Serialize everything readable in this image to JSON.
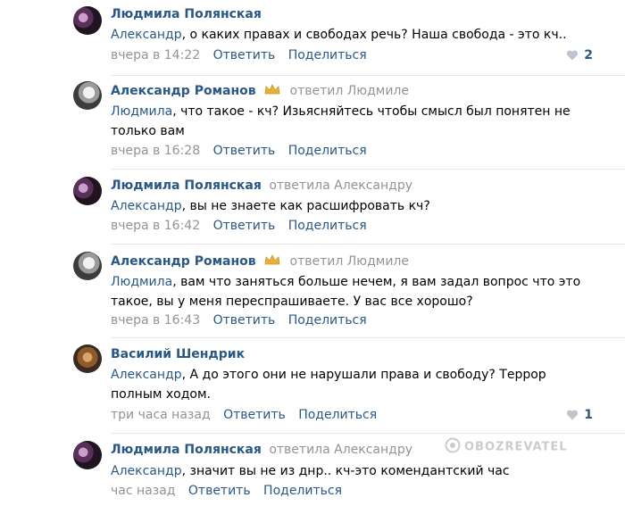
{
  "comments": [
    {
      "author": "Людмила Полянская",
      "replied": "",
      "addressee": "Александр",
      "text": ", о каких правах и свободах речь? Наша свобода - это кч..",
      "time": "вчера в 14:22",
      "reply_label": "Ответить",
      "share_label": "Поделиться",
      "likes": "2",
      "avatar": "lyudmila"
    },
    {
      "author": "Александр Романов",
      "replied": "ответил Людмиле",
      "addressee": "Людмила",
      "text": ", что такое - кч? Изьясняйтесь чтобы смысл был понятен не только вам",
      "time": "вчера в 16:28",
      "reply_label": "Ответить",
      "share_label": "Поделиться",
      "likes": "",
      "avatar": "romanov"
    },
    {
      "author": "Людмила Полянская",
      "replied": "ответила Александру",
      "addressee": "Александр",
      "text": ", вы не знаете как расшифровать кч?",
      "time": "вчера в 16:42",
      "reply_label": "Ответить",
      "share_label": "Поделиться",
      "likes": "",
      "avatar": "lyudmila"
    },
    {
      "author": "Александр Романов",
      "replied": "ответил Людмиле",
      "addressee": "Людмила",
      "text": ", вам что заняться больше нечем, я вам задал вопрос что это такое, вы у меня переспрашиваете. У вас все хорошо?",
      "time": "вчера в 16:43",
      "reply_label": "Ответить",
      "share_label": "Поделиться",
      "likes": "",
      "avatar": "romanov"
    },
    {
      "author": "Василий Шендрик",
      "replied": "",
      "addressee": "Александр",
      "text": ", А до этого они не нарушали права и свободу? Террор полным ходом.",
      "time": "три часа назад",
      "reply_label": "Ответить",
      "share_label": "Поделиться",
      "likes": "1",
      "avatar": "shendrik"
    },
    {
      "author": "Людмила Полянская",
      "replied": "ответила Александру",
      "addressee": "Александр",
      "text": ", значит вы не из днр.. кч-это комендантский час",
      "time": "час назад",
      "reply_label": "Ответить",
      "share_label": "Поделиться",
      "likes": "",
      "avatar": "lyudmila"
    }
  ],
  "watermark": "OBOZREVATEL",
  "colors": {
    "link": "#2a5885",
    "muted": "#939393",
    "separator": "#e7e8ec"
  }
}
